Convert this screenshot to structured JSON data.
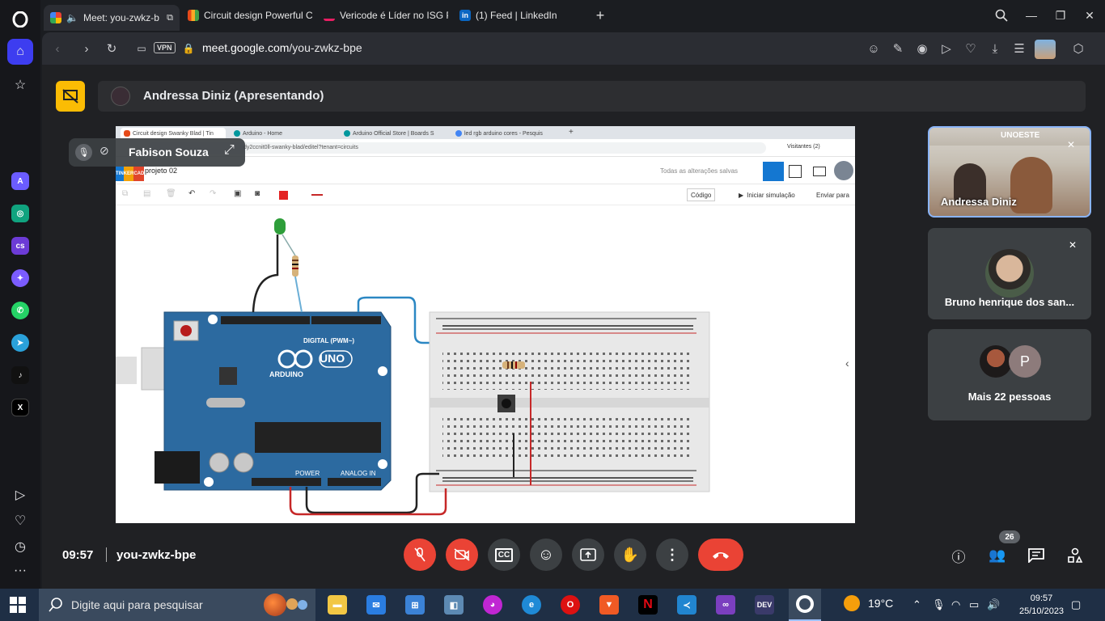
{
  "browser": {
    "tabs": [
      {
        "label": "Meet: you-zwkz-b",
        "active": true
      },
      {
        "label": "Circuit design Powerful Ci"
      },
      {
        "label": "Vericode é Líder no ISG P"
      },
      {
        "label": "(1) Feed | LinkedIn"
      }
    ],
    "vpn_label": "VPN",
    "url_host": "meet.google.com",
    "url_path": "/you-zwkz-bpe"
  },
  "meet": {
    "presenter_label": "Andressa Diniz (Apresentando)",
    "self_name": "Fabison Souza",
    "participants": [
      {
        "name": "Andressa Diniz"
      },
      {
        "name": "Bruno henrique dos san..."
      },
      {
        "name": "Mais 22 pessoas",
        "initial": "P"
      }
    ],
    "overlay_text": "UNOESTE",
    "clock": "09:57",
    "meeting_code": "you-zwkz-bpe",
    "participant_count": "26"
  },
  "shared_screen": {
    "tabs": [
      "Circuit design Swanky Blad | Tin",
      "Arduino - Home",
      "Arduino Official Store | Boards S",
      "led rgb arduino cores - Pesquis"
    ],
    "url": "dy2ccnit0ll-swanky-blad/editel?tenant=circuits",
    "visitors_label": "Visitantes (2)",
    "logo_letters": [
      "TIN",
      "KER",
      "CAD"
    ],
    "project_name": "projeto 02",
    "saved_status": "Todas as alterações salvas",
    "code_button": "Código",
    "simulate_button": "Iniciar simulação",
    "send_button": "Enviar para",
    "board_label": "UNO",
    "board_brand": "ARDUINO",
    "digital_label": "DIGITAL (PWM~)",
    "power_label": "POWER",
    "analog_label": "ANALOG IN"
  },
  "taskbar": {
    "search_placeholder": "Digite aqui para pesquisar",
    "temperature": "19°C",
    "time": "09:57",
    "date": "25/10/2023"
  },
  "colors": {
    "meet_bg": "#202124",
    "end_call": "#ea4335",
    "accent": "#8ab4f8",
    "arduino_blue": "#2c6aa0"
  }
}
